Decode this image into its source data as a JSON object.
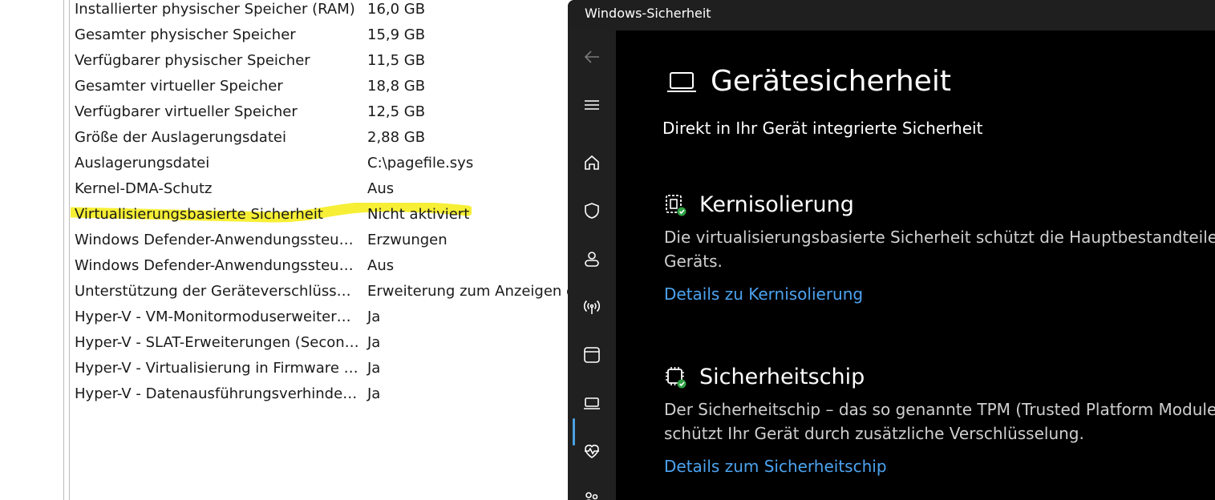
{
  "system_info": {
    "rows": [
      {
        "item": "Installierter physischer Speicher (RAM)",
        "value": "16,0 GB"
      },
      {
        "item": "Gesamter physischer Speicher",
        "value": "15,9 GB"
      },
      {
        "item": "Verfügbarer physischer Speicher",
        "value": "11,5 GB"
      },
      {
        "item": "Gesamter virtueller Speicher",
        "value": "18,8 GB"
      },
      {
        "item": "Verfügbarer virtueller Speicher",
        "value": "12,5 GB"
      },
      {
        "item": "Größe der Auslagerungsdatei",
        "value": "2,88 GB"
      },
      {
        "item": "Auslagerungsdatei",
        "value": "C:\\pagefile.sys"
      },
      {
        "item": "Kernel-DMA-Schutz",
        "value": "Aus"
      },
      {
        "item": "Virtualisierungsbasierte Sicherheit",
        "value": "Nicht aktiviert"
      },
      {
        "item": "Windows Defender-Anwendungssteuer…",
        "value": "Erzwungen"
      },
      {
        "item": "Windows Defender-Anwendungssteuer…",
        "value": "Aus"
      },
      {
        "item": "Unterstützung der Geräteverschlüsselu…",
        "value": "Erweiterung zum Anzeigen er"
      },
      {
        "item": "Hyper-V - VM-Monitormoduserweiteru…",
        "value": "Ja"
      },
      {
        "item": "Hyper-V - SLAT-Erweiterungen (Second…",
        "value": "Ja"
      },
      {
        "item": "Hyper-V - Virtualisierung in Firmware a…",
        "value": "Ja"
      },
      {
        "item": "Hyper-V - Datenausführungsverhinderu…",
        "value": "Ja"
      }
    ],
    "highlight_color": "#f5ee2a"
  },
  "security_window": {
    "title": "Windows-Sicherheit",
    "page_title": "Gerätesicherheit",
    "subtitle": "Direkt in Ihr Gerät integrierte Sicherheit",
    "sections": [
      {
        "title": "Kernisolierung",
        "description": "Die virtualisierungsbasierte Sicherheit schützt die Hauptbestandteile I Geräts.",
        "link": "Details zu Kernisolierung",
        "icon": "core-isolation-icon"
      },
      {
        "title": "Sicherheitschip",
        "description": "Der Sicherheitschip – das so genannte TPM (Trusted Platform Module schützt Ihr Gerät durch zusätzliche Verschlüsselung.",
        "link": "Details zum Sicherheitschip",
        "icon": "security-chip-icon"
      }
    ],
    "nav": [
      "back-arrow-icon",
      "hamburger-menu-icon",
      "home-icon",
      "shield-icon",
      "account-icon",
      "firewall-network-icon",
      "app-browser-control-icon",
      "device-security-icon",
      "heart-health-icon",
      "family-icon"
    ],
    "colors": {
      "background": "#000000",
      "rail": "#202020",
      "link": "#4ca3f0",
      "accent": "#4ca0e0",
      "ok_badge": "#2ea043"
    }
  }
}
